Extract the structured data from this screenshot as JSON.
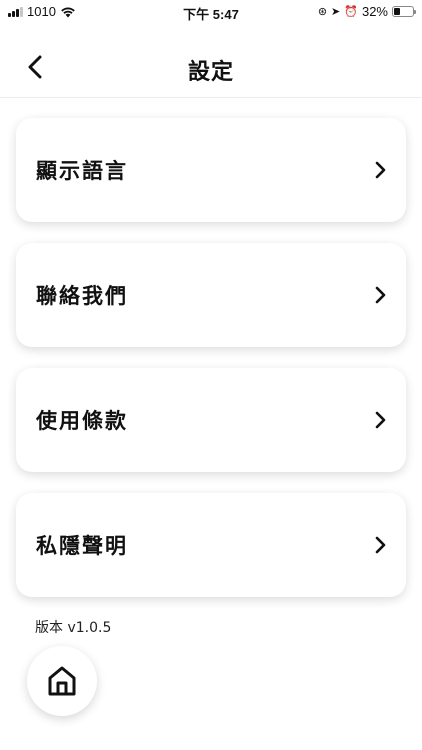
{
  "status_bar": {
    "carrier": "1010",
    "time": "下午 5:47",
    "battery_text": "32%",
    "battery_level": 0.32,
    "icons": [
      "signal-icon",
      "wifi-icon",
      "screen-rotation-lock-icon",
      "location-icon",
      "alarm-icon",
      "battery-icon"
    ]
  },
  "header": {
    "title": "設定",
    "back_icon": "chevron-left-icon"
  },
  "menu": {
    "items": [
      {
        "label": "顯示語言",
        "icon": "chevron-right-icon"
      },
      {
        "label": "聯絡我們",
        "icon": "chevron-right-icon"
      },
      {
        "label": "使用條款",
        "icon": "chevron-right-icon"
      },
      {
        "label": "私隱聲明",
        "icon": "chevron-right-icon"
      }
    ]
  },
  "footer": {
    "version": "版本 v1.0.5",
    "home_icon": "home-icon"
  }
}
